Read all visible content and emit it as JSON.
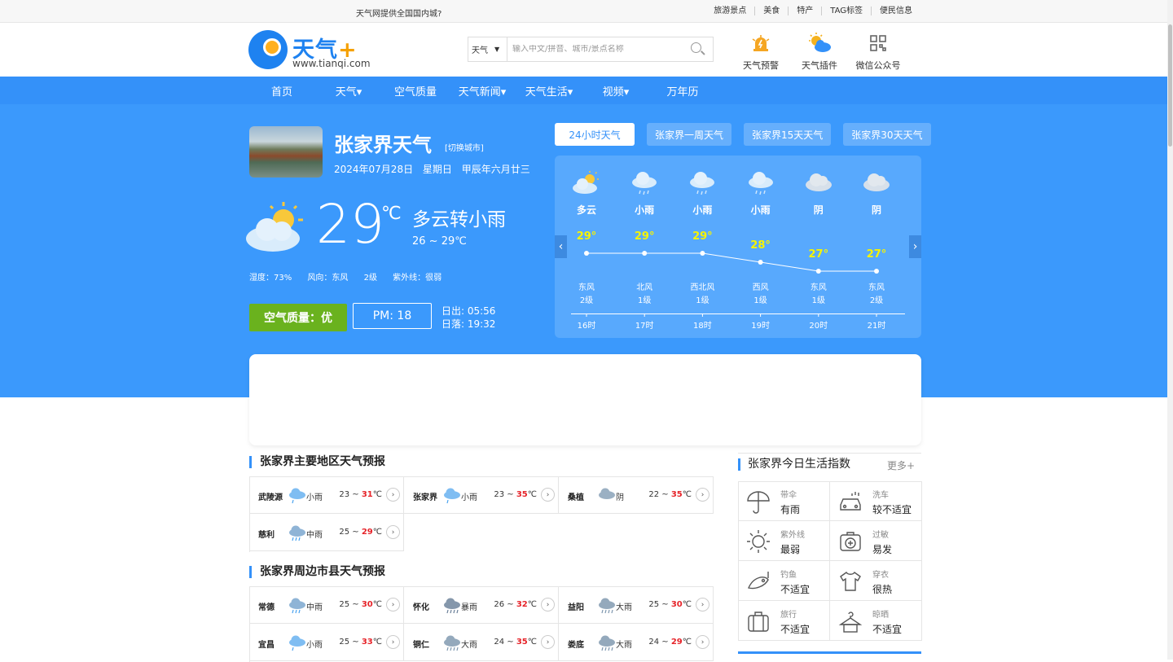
{
  "topbar": {
    "left_text": "天气网提供全国国内城?",
    "links": [
      "旅游景点",
      "美食",
      "特产",
      "TAG标签",
      "便民信息"
    ]
  },
  "logo": {
    "brand": "天气",
    "plus": "+",
    "url": "www.tianqi.com"
  },
  "search": {
    "select": "天气",
    "placeholder": "输入中文/拼音、城市/景点名称"
  },
  "header_icons": [
    {
      "label": "天气预警",
      "icon": "warning-bell-icon"
    },
    {
      "label": "天气插件",
      "icon": "sun-cloud-icon"
    },
    {
      "label": "微信公众号",
      "icon": "qr-code-icon"
    }
  ],
  "nav": [
    "首页",
    "天气▾",
    "空气质量",
    "天气新闻▾",
    "天气生活▾",
    "视频▾",
    "万年历"
  ],
  "city": {
    "name": "张家界天气",
    "switch": "[切换城市]",
    "date": "2024年07月28日 星期日 甲辰年六月廿三"
  },
  "current": {
    "temp": "29",
    "unit": "℃",
    "desc": "多云转小雨",
    "range": "26 ~ 29℃",
    "details": "湿度：73% 风向：东风 2级 紫外线：很弱",
    "air_quality": "空气质量：优",
    "pm": "PM: 18",
    "sunrise": "日出: 05:56",
    "sunset": "日落: 19:32"
  },
  "tabs": [
    "24小时天气",
    "张家界一周天气",
    "张家界15天天气",
    "张家界30天天气"
  ],
  "hourly": [
    {
      "cond": "多云",
      "temp": "29°",
      "t": 29,
      "wind": "东风",
      "level": "2级",
      "hour": "16时",
      "icon": "partly-cloudy-icon"
    },
    {
      "cond": "小雨",
      "temp": "29°",
      "t": 29,
      "wind": "北风",
      "level": "1级",
      "hour": "17时",
      "icon": "light-rain-icon"
    },
    {
      "cond": "小雨",
      "temp": "29°",
      "t": 29,
      "wind": "西北风",
      "level": "1级",
      "hour": "18时",
      "icon": "light-rain-icon"
    },
    {
      "cond": "小雨",
      "temp": "28°",
      "t": 28,
      "wind": "西风",
      "level": "1级",
      "hour": "19时",
      "icon": "light-rain-icon"
    },
    {
      "cond": "阴",
      "temp": "27°",
      "t": 27,
      "wind": "东风",
      "level": "1级",
      "hour": "20时",
      "icon": "overcast-icon"
    },
    {
      "cond": "阴",
      "temp": "27°",
      "t": 27,
      "wind": "东风",
      "level": "2级",
      "hour": "21时",
      "icon": "overcast-icon"
    }
  ],
  "section1": {
    "title": "张家界主要地区天气预报",
    "rows": [
      {
        "name": "武陵源",
        "cond": "小雨",
        "low": "23 ~ ",
        "high": "31",
        "unit": "℃",
        "icon": "light-rain-icon"
      },
      {
        "name": "张家界",
        "cond": "小雨",
        "low": "23 ~ ",
        "high": "35",
        "unit": "℃",
        "icon": "light-rain-icon"
      },
      {
        "name": "桑植",
        "cond": "阴",
        "low": "22 ~ ",
        "high": "35",
        "unit": "℃",
        "icon": "overcast-icon"
      },
      {
        "name": "慈利",
        "cond": "中雨",
        "low": "25 ~ ",
        "high": "29",
        "unit": "℃",
        "icon": "moderate-rain-icon"
      }
    ]
  },
  "section2": {
    "title": "张家界周边市县天气预报",
    "rows": [
      {
        "name": "常德",
        "cond": "中雨",
        "low": "25 ~ ",
        "high": "30",
        "unit": "℃",
        "icon": "moderate-rain-icon"
      },
      {
        "name": "怀化",
        "cond": "暴雨",
        "low": "26 ~ ",
        "high": "32",
        "unit": "℃",
        "icon": "storm-rain-icon"
      },
      {
        "name": "益阳",
        "cond": "大雨",
        "low": "25 ~ ",
        "high": "30",
        "unit": "℃",
        "icon": "heavy-rain-icon"
      },
      {
        "name": "宜昌",
        "cond": "小雨",
        "low": "25 ~ ",
        "high": "33",
        "unit": "℃",
        "icon": "light-rain-icon"
      },
      {
        "name": "铜仁",
        "cond": "大雨",
        "low": "24 ~ ",
        "high": "35",
        "unit": "℃",
        "icon": "heavy-rain-icon"
      },
      {
        "name": "娄底",
        "cond": "大雨",
        "low": "24 ~ ",
        "high": "29",
        "unit": "℃",
        "icon": "heavy-rain-icon"
      }
    ]
  },
  "life": {
    "title": "张家界今日生活指数",
    "more": "更多+",
    "items": [
      {
        "key": "带伞",
        "value": "有雨",
        "icon": "umbrella-icon"
      },
      {
        "key": "洗车",
        "value": "较不适宜",
        "icon": "car-wash-icon"
      },
      {
        "key": "紫外线",
        "value": "最弱",
        "icon": "uv-sun-icon"
      },
      {
        "key": "过敏",
        "value": "易发",
        "icon": "medical-kit-icon"
      },
      {
        "key": "钓鱼",
        "value": "不适宜",
        "icon": "fish-icon"
      },
      {
        "key": "穿衣",
        "value": "很热",
        "icon": "tshirt-icon"
      },
      {
        "key": "旅行",
        "value": "不适宜",
        "icon": "suitcase-icon"
      },
      {
        "key": "晾晒",
        "value": "不适宜",
        "icon": "hanger-icon"
      }
    ]
  },
  "colors": {
    "primary": "#3491f9",
    "hero": "#3b99fc",
    "air_good": "#6ab21e",
    "temp_yellow": "#f7f400",
    "high_red": "#e6242a"
  }
}
